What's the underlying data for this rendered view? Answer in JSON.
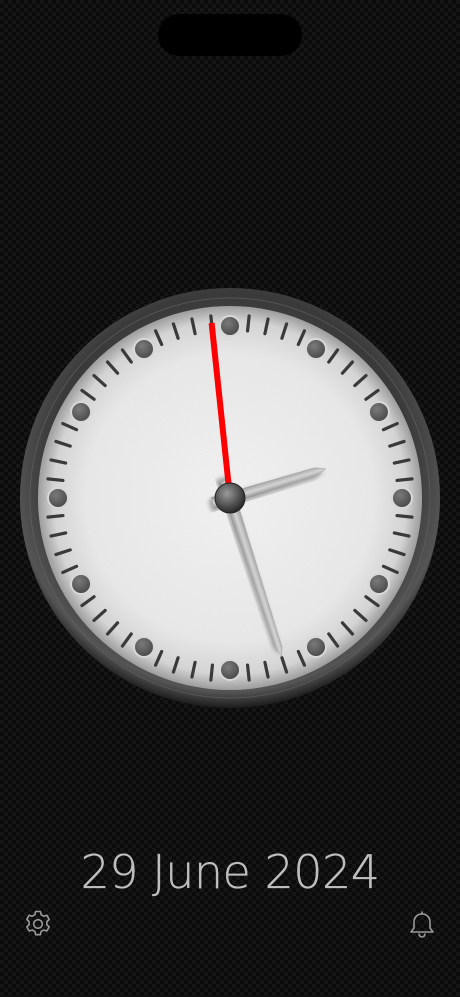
{
  "date": {
    "text": "29 June 2024"
  },
  "time": {
    "hour": 2,
    "minute": 26,
    "second": 59
  },
  "icons": {
    "settings": "gear-icon",
    "alarm": "bell-icon"
  },
  "colors": {
    "second_hand": "#ff0000",
    "dial": "#f2f2f2",
    "bezel": "#3a3a3a",
    "date_text": "#bfbfbf",
    "icon": "#9a9a9a"
  }
}
